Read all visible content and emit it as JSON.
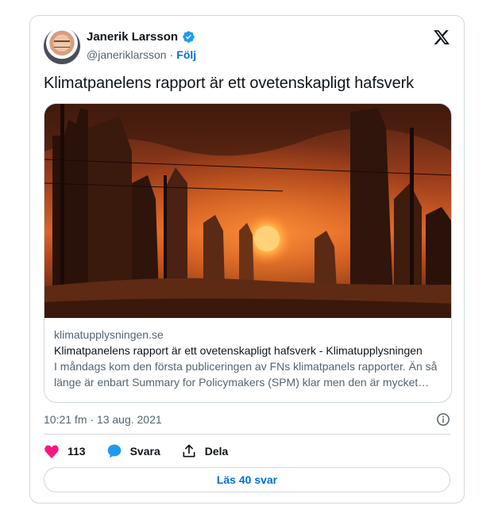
{
  "author": {
    "name": "Janerik Larsson",
    "handle": "@janeriklarsson",
    "separator": "·",
    "follow_label": "Följ"
  },
  "tweet": {
    "text": "Klimatpanelens rapport är ett ovetenskapligt hafsverk",
    "timestamp": "10:21 fm · 13 aug. 2021"
  },
  "link_card": {
    "domain": "klimatupplysningen.se",
    "title": "Klimatpanelens rapport är ett ovetenskapligt hafsverk - Klimatupplysningen",
    "description": "I måndags kom den första publiceringen av FNs klimatpanels rapporter. Än så länge är enbart Summary for Policymakers (SPM) klar men den är mycket lång"
  },
  "actions": {
    "like_count": "113",
    "reply_label": "Svara",
    "share_label": "Dela"
  },
  "read_replies_label": "Läs 40 svar",
  "colors": {
    "like": "#f91880",
    "reply": "#1d9bf0",
    "link_blue": "#006fd6",
    "verified": "#1d9bf0",
    "border": "#cfd9de",
    "secondary_text": "#536471"
  },
  "icons": {
    "verified": "verified-badge-icon",
    "x_logo": "x-logo-icon",
    "info": "info-icon",
    "like": "heart-icon",
    "reply": "speech-bubble-icon",
    "share": "share-upload-icon"
  }
}
